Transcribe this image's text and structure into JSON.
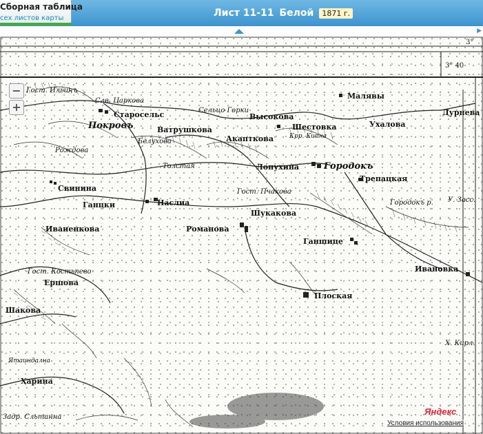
{
  "header": {
    "sheet_tab_line1": "Сборная таблица",
    "sheet_tab_line2": "сех листов карты",
    "sheet_title": "Лист 11-11",
    "place_title": "Белой",
    "year_badge": "1871 г."
  },
  "map": {
    "zoom_out": "−",
    "zoom_in": "+",
    "border_labels": [
      "3°",
      "3° 40"
    ],
    "places": [
      "Гост. Ильинъ",
      "Слв. Царкова",
      "Старосельс",
      "Покровъ",
      "Ватрушкова",
      "Сельцо Горки",
      "Белухова",
      "Высокова",
      "Шестовка",
      "Малявы",
      "Дурнева",
      "Ухалова",
      "Акапткова",
      "Крр. Кипна",
      "Толстая",
      "Лопухина",
      "Городокъ",
      "Трепацкая",
      "Рождова",
      "Свинина",
      "Ганцки",
      "Наслиа",
      "Гост. Пчакова",
      "Шукакова",
      "Романова",
      "Ганшице",
      "Иваиенкова",
      "Ершова",
      "Гост. Костьпево",
      "Шакова",
      "Плоская",
      "Ивановка",
      "Харина",
      "Ятаиндална",
      "Задр. Сльтанна",
      "Городокъ р.",
      "У. Засс.",
      "Х. Кирл."
    ]
  },
  "footer": {
    "yandex": "Яндекс",
    "terms": "Условия использования"
  }
}
